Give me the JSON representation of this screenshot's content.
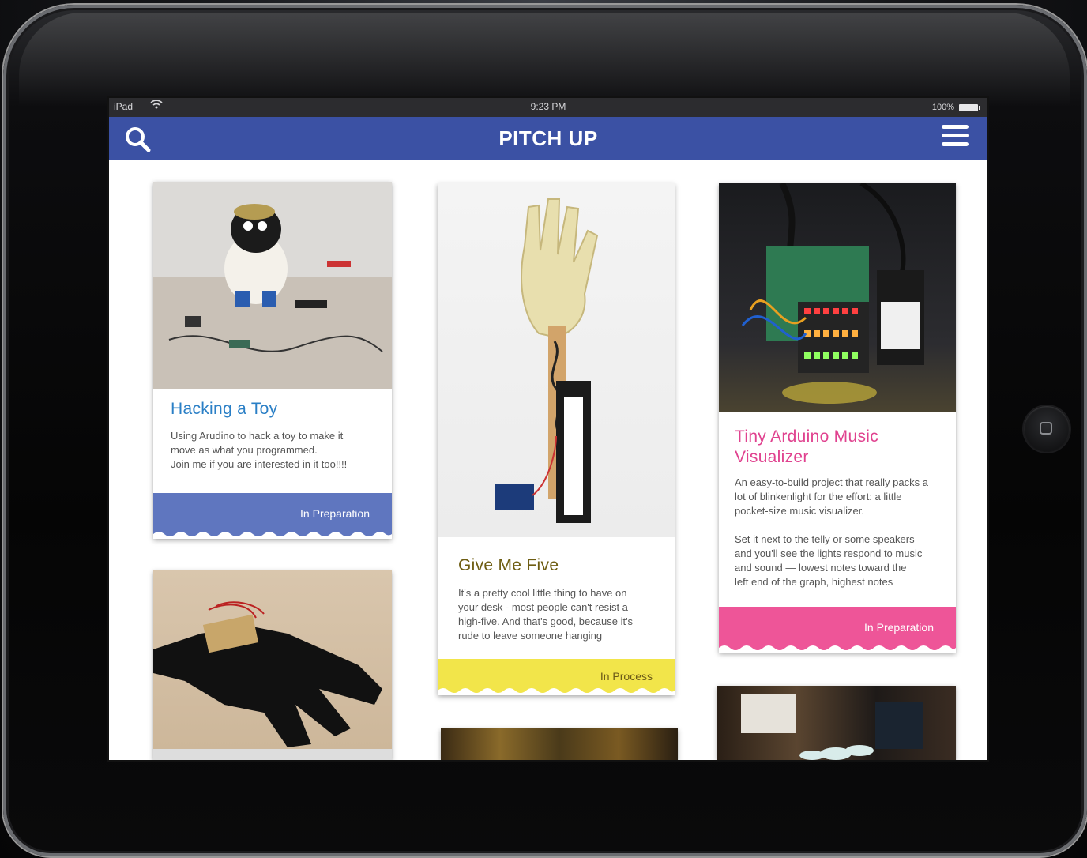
{
  "status_bar": {
    "carrier": "iPad",
    "time": "9:23 PM",
    "battery": "100%"
  },
  "app": {
    "title": "PITCH UP"
  },
  "cards": [
    {
      "title": "Hacking a Toy",
      "description": "Using Arudino to hack a toy to make it\nmove as what you programmed.\nJoin me if you are interested in it too!!!!",
      "status": "In Preparation",
      "accent": "#5f76bf",
      "title_color": "#2a7fc6"
    },
    {
      "title": "Give Me Five",
      "description": "It's a pretty cool little thing to have on\nyour desk - most people can't resist a\nhigh-five.  And that's good, because it's\nrude to leave someone hanging",
      "status": "In Process",
      "accent": "#f2e54a",
      "title_color": "#6e5d12"
    },
    {
      "title": "Tiny Arduino Music\nVisualizer",
      "description": "An easy-to-build project that really packs a\nlot of blinkenlight for the effort: a little\npocket-size music visualizer.\n\nSet it next to the telly or some speakers\nand you'll see the lights respond to music\nand sound — lowest notes toward the\nleft end of the graph, highest notes",
      "status": "In Preparation",
      "accent": "#ee5598",
      "title_color": "#e0428f"
    }
  ],
  "icons": {
    "search": "search-icon",
    "menu": "hamburger-menu-icon",
    "wifi": "wifi-icon",
    "battery": "battery-icon",
    "home": "home-button-icon"
  }
}
